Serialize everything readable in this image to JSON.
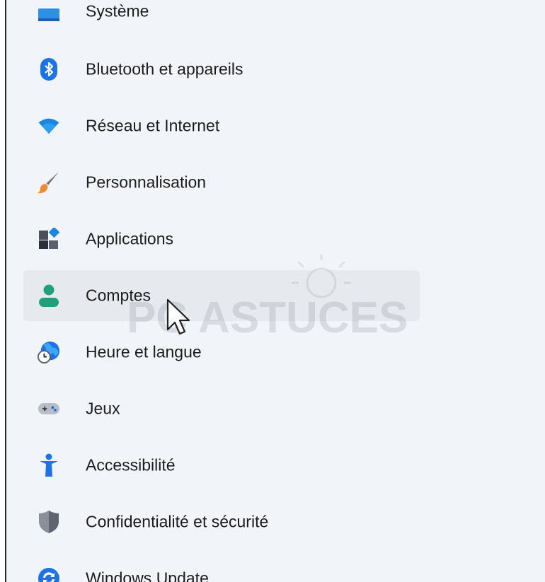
{
  "sidebar": {
    "items": [
      {
        "label": "Système",
        "icon": "display-icon"
      },
      {
        "label": "Bluetooth et appareils",
        "icon": "bluetooth-icon"
      },
      {
        "label": "Réseau et Internet",
        "icon": "wifi-icon"
      },
      {
        "label": "Personnalisation",
        "icon": "paintbrush-icon"
      },
      {
        "label": "Applications",
        "icon": "apps-icon"
      },
      {
        "label": "Comptes",
        "icon": "account-icon",
        "selected": true
      },
      {
        "label": "Heure et langue",
        "icon": "globe-clock-icon"
      },
      {
        "label": "Jeux",
        "icon": "gamepad-icon"
      },
      {
        "label": "Accessibilité",
        "icon": "accessibility-icon"
      },
      {
        "label": "Confidentialité et sécurité",
        "icon": "shield-icon"
      },
      {
        "label": "Windows Update",
        "icon": "update-icon"
      }
    ]
  },
  "watermark": {
    "text": "PC ASTUCES"
  },
  "colors": {
    "accent": "#0067c0",
    "selected_bg": "#e6e9ee",
    "window_bg": "#f1f4f9"
  }
}
